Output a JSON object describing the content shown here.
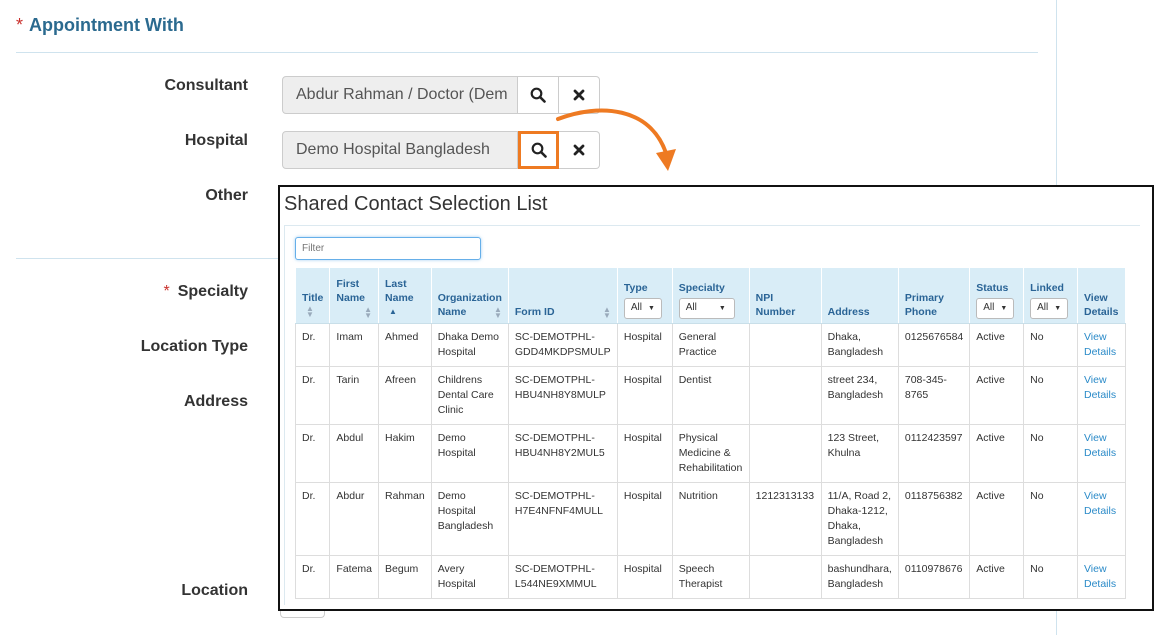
{
  "form": {
    "section_title": "Appointment With",
    "required_mark": "*",
    "consultant": {
      "label": "Consultant",
      "value": "Abdur Rahman / Doctor (Dem"
    },
    "hospital": {
      "label": "Hospital",
      "value": "Demo Hospital Bangladesh"
    },
    "other": {
      "label": "Other"
    },
    "specialty": {
      "label": "Specialty"
    },
    "location_type": {
      "label": "Location Type"
    },
    "address": {
      "label": "Address"
    },
    "location": {
      "label": "Location"
    },
    "icons": {
      "search": "search-icon",
      "clear": "close-icon"
    }
  },
  "modal": {
    "title": "Shared Contact Selection List",
    "filter_placeholder": "Filter",
    "columns": {
      "title": "Title",
      "first_name_1": "First",
      "first_name_2": "Name",
      "last_name_1": "Last",
      "last_name_2": "Name",
      "org_1": "Organization",
      "org_2": "Name",
      "form_id": "Form ID",
      "type": "Type",
      "type_filter": "All",
      "specialty": "Specialty",
      "specialty_filter": "All",
      "npi_1": "NPI",
      "npi_2": "Number",
      "address": "Address",
      "phone_1": "Primary",
      "phone_2": "Phone",
      "status": "Status",
      "status_filter": "All",
      "linked": "Linked",
      "linked_filter": "All",
      "view_1": "View",
      "view_2": "Details"
    },
    "rows": [
      {
        "title": "Dr.",
        "first": "Imam",
        "last": "Ahmed",
        "org": [
          "Dhaka Demo",
          "Hospital"
        ],
        "form_id": [
          "SC-DEMOTPHL-",
          "GDD4MKDPSMULP"
        ],
        "type": "Hospital",
        "specialty": [
          "General",
          "Practice"
        ],
        "npi": "",
        "address": [
          "Dhaka,",
          "Bangladesh"
        ],
        "phone": [
          "0125676584"
        ],
        "status": "Active",
        "linked": "No",
        "view": [
          "View",
          "Details"
        ]
      },
      {
        "title": "Dr.",
        "first": "Tarin",
        "last": "Afreen",
        "org": [
          "Childrens",
          "Dental Care",
          "Clinic"
        ],
        "form_id": [
          "SC-DEMOTPHL-",
          "HBU4NH8Y8MULP"
        ],
        "type": "Hospital",
        "specialty": [
          "Dentist"
        ],
        "npi": "",
        "address": [
          "street 234,",
          "Bangladesh"
        ],
        "phone": [
          "708-345-",
          "8765"
        ],
        "status": "Active",
        "linked": "No",
        "view": [
          "View",
          "Details"
        ]
      },
      {
        "title": "Dr.",
        "first": "Abdul",
        "last": "Hakim",
        "org": [
          "Demo",
          "Hospital"
        ],
        "form_id": [
          "SC-DEMOTPHL-",
          "HBU4NH8Y2MUL5"
        ],
        "type": "Hospital",
        "specialty": [
          "Physical",
          "Medicine &",
          "Rehabilitation"
        ],
        "npi": "",
        "address": [
          "123 Street,",
          "Khulna"
        ],
        "phone": [
          "0112423597"
        ],
        "status": "Active",
        "linked": "No",
        "view": [
          "View",
          "Details"
        ]
      },
      {
        "title": "Dr.",
        "first": "Abdur",
        "last": "Rahman",
        "org": [
          "Demo",
          "Hospital",
          "Bangladesh"
        ],
        "form_id": [
          "SC-DEMOTPHL-",
          "H7E4NFNF4MULL"
        ],
        "type": "Hospital",
        "specialty": [
          "Nutrition"
        ],
        "npi": "1212313133",
        "address": [
          "11/A, Road 2,",
          "Dhaka-1212,",
          "Dhaka,",
          "Bangladesh"
        ],
        "phone": [
          "0118756382"
        ],
        "status": "Active",
        "linked": "No",
        "view": [
          "View",
          "Details"
        ]
      },
      {
        "title": "Dr.",
        "first": "Fatema",
        "last": "Begum",
        "org": [
          "Avery",
          "Hospital"
        ],
        "form_id": [
          "SC-DEMOTPHL-",
          "L544NE9XMMUL"
        ],
        "type": "Hospital",
        "specialty": [
          "Speech",
          "Therapist"
        ],
        "npi": "",
        "address": [
          "bashundhara,",
          "Bangladesh"
        ],
        "phone": [
          "0110978676"
        ],
        "status": "Active",
        "linked": "No",
        "view": [
          "View",
          "Details"
        ]
      }
    ]
  },
  "colors": {
    "accent": "#2b6a8f",
    "highlight": "#ee7a22",
    "required": "#c9302c",
    "header_bg": "#d9edf7",
    "link": "#2a8ac8"
  }
}
